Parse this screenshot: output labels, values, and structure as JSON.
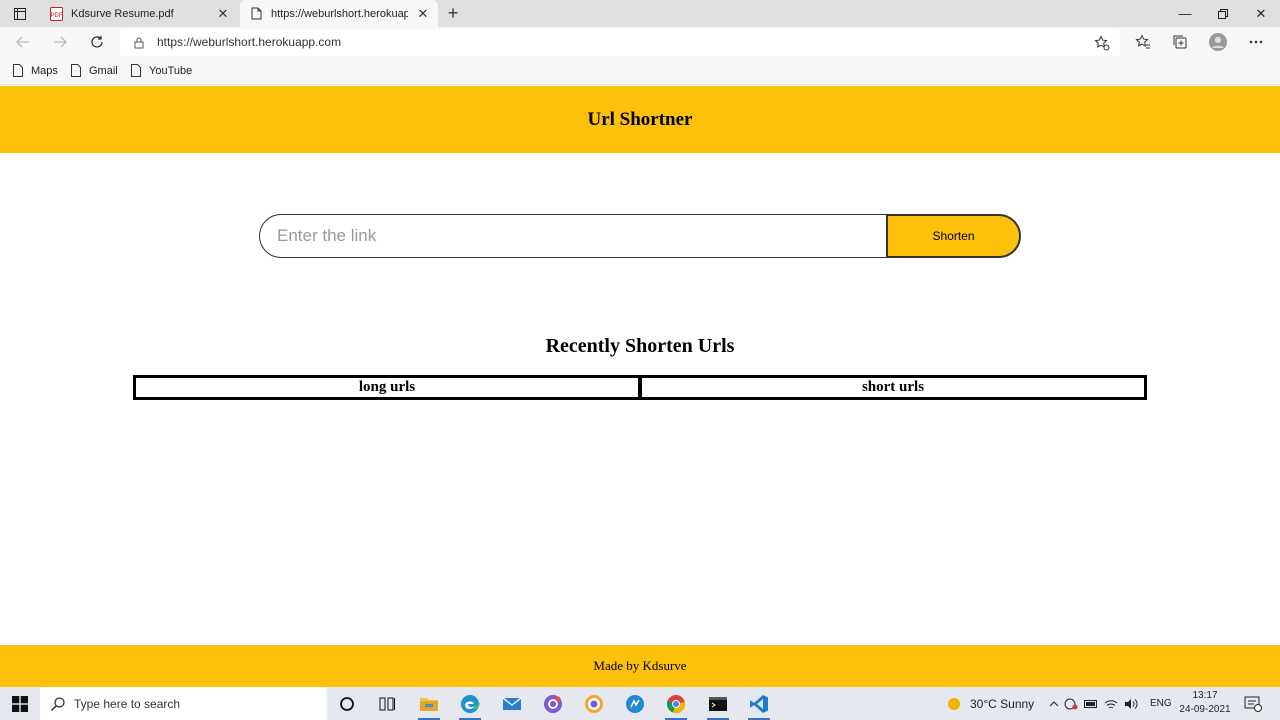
{
  "browser": {
    "tabs": [
      {
        "title": "Kdsurve Resume.pdf"
      },
      {
        "title": "https://weburlshort.herokuapp.c"
      }
    ],
    "url": "https://weburlshort.herokuapp.com",
    "bookmarks": [
      "Maps",
      "Gmail",
      "YouTube"
    ]
  },
  "page": {
    "header_title": "Url Shortner",
    "input_placeholder": "Enter the link",
    "shorten_label": "Shorten",
    "recent_title": "Recently Shorten Urls",
    "table_headers": [
      "long urls",
      "short urls"
    ],
    "footer_text": "Made by Kdsurve"
  },
  "taskbar": {
    "search_placeholder": "Type here to search",
    "weather": "30°C  Sunny",
    "language": "ENG",
    "time": "13:17",
    "date": "24-09-2021"
  },
  "colors": {
    "accent": "#fdc10c"
  }
}
